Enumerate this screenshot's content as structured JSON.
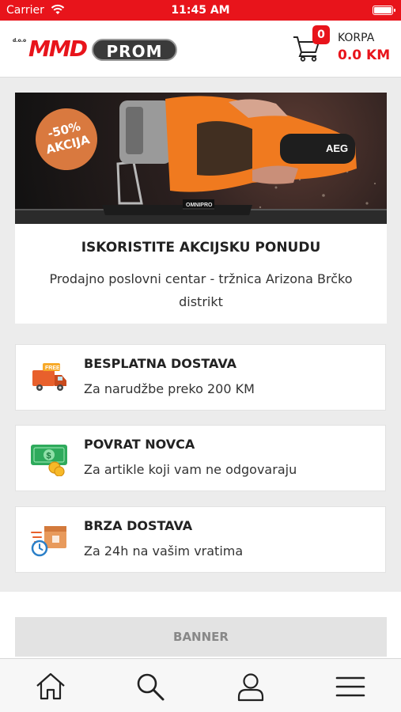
{
  "status_bar": {
    "carrier": "Carrier",
    "time": "11:45 AM"
  },
  "header": {
    "logo": {
      "prefix": "d.o.o",
      "brand_left": "MMD",
      "brand_right": "PROM"
    },
    "cart": {
      "count": "0",
      "label": "KORPA",
      "amount": "0.0 KM"
    }
  },
  "promo": {
    "badge_line1": "-50%",
    "badge_line2": "AKCIJA",
    "image_brand": "AEG",
    "title": "ISKORISTITE AKCIJSKU PONUDU",
    "text": "Prodajno poslovni centar - tržnica Arizona Brčko distrikt"
  },
  "features": [
    {
      "icon": "delivery-truck-icon",
      "title": "BESPLATNA DOSTAVA",
      "text": "Za narudžbe preko 200 KM"
    },
    {
      "icon": "money-back-icon",
      "title": "POVRAT NOVCA",
      "text": "Za artikle koji vam ne odgovaraju"
    },
    {
      "icon": "fast-delivery-icon",
      "title": "BRZA DOSTAVA",
      "text": "Za 24h na vašim vratima"
    }
  ],
  "banner": {
    "label": "BANNER"
  },
  "bottom_nav": [
    "home-icon",
    "search-icon",
    "user-icon",
    "menu-icon"
  ],
  "colors": {
    "accent": "#e8141b",
    "background": "#ececec"
  }
}
